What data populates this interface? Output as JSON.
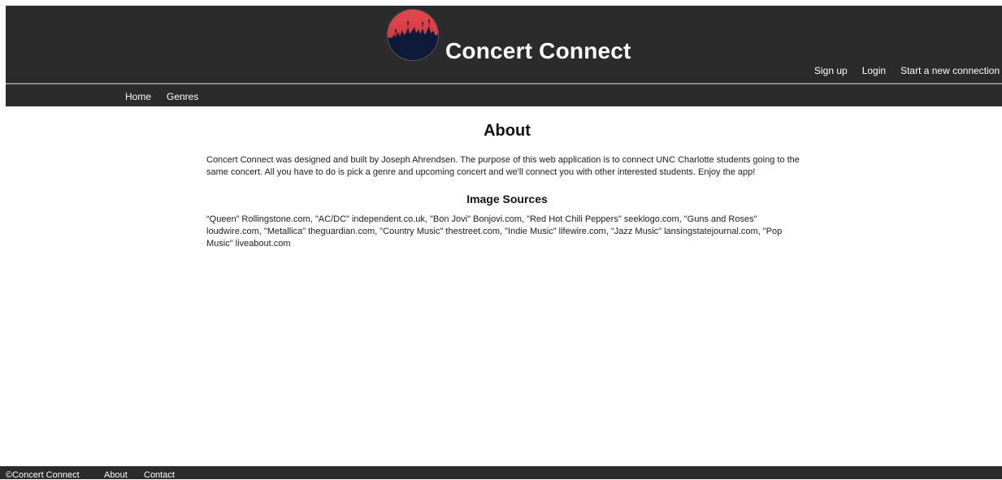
{
  "header": {
    "site_title": "Concert Connect",
    "logo_icon": "concert-crowd-logo",
    "auth_nav": [
      {
        "label": "Sign up"
      },
      {
        "label": "Login"
      },
      {
        "label": "Start a new connection"
      }
    ]
  },
  "subnav": {
    "home": "Home",
    "genres": "Genres"
  },
  "main": {
    "title": "About",
    "description": "Concert Connect was designed and built by Joseph Ahrendsen. The purpose of this web application is to connect UNC Charlotte students going to the same concert. All you have to do is pick a genre and upcoming concert and we'll connect you with other interested students. Enjoy the app!",
    "sources_title": "Image Sources",
    "sources_text": "“Queen” Rollingstone.com, \"AC/DC\" independent.co.uk, \"Bon Jovi\" Bonjovi.com, \"Red Hot Chili Peppers\" seeklogo.com, \"Guns and Roses\" loudwire.com, \"Metallica\" theguardian.com, \"Country Music\" thestreet.com, \"Indie Music\" lifewire.com, \"Jazz Music\" lansingstatejournal.com, \"Pop Music\" liveabout.com"
  },
  "footer": {
    "copyright": "©Concert Connect",
    "about": "About",
    "contact": "Contact"
  },
  "colors": {
    "header_bg": "#2b2b2b",
    "logo_top": "#e0474c",
    "logo_bottom": "#0d1a3a",
    "text_light": "#ffffff"
  }
}
